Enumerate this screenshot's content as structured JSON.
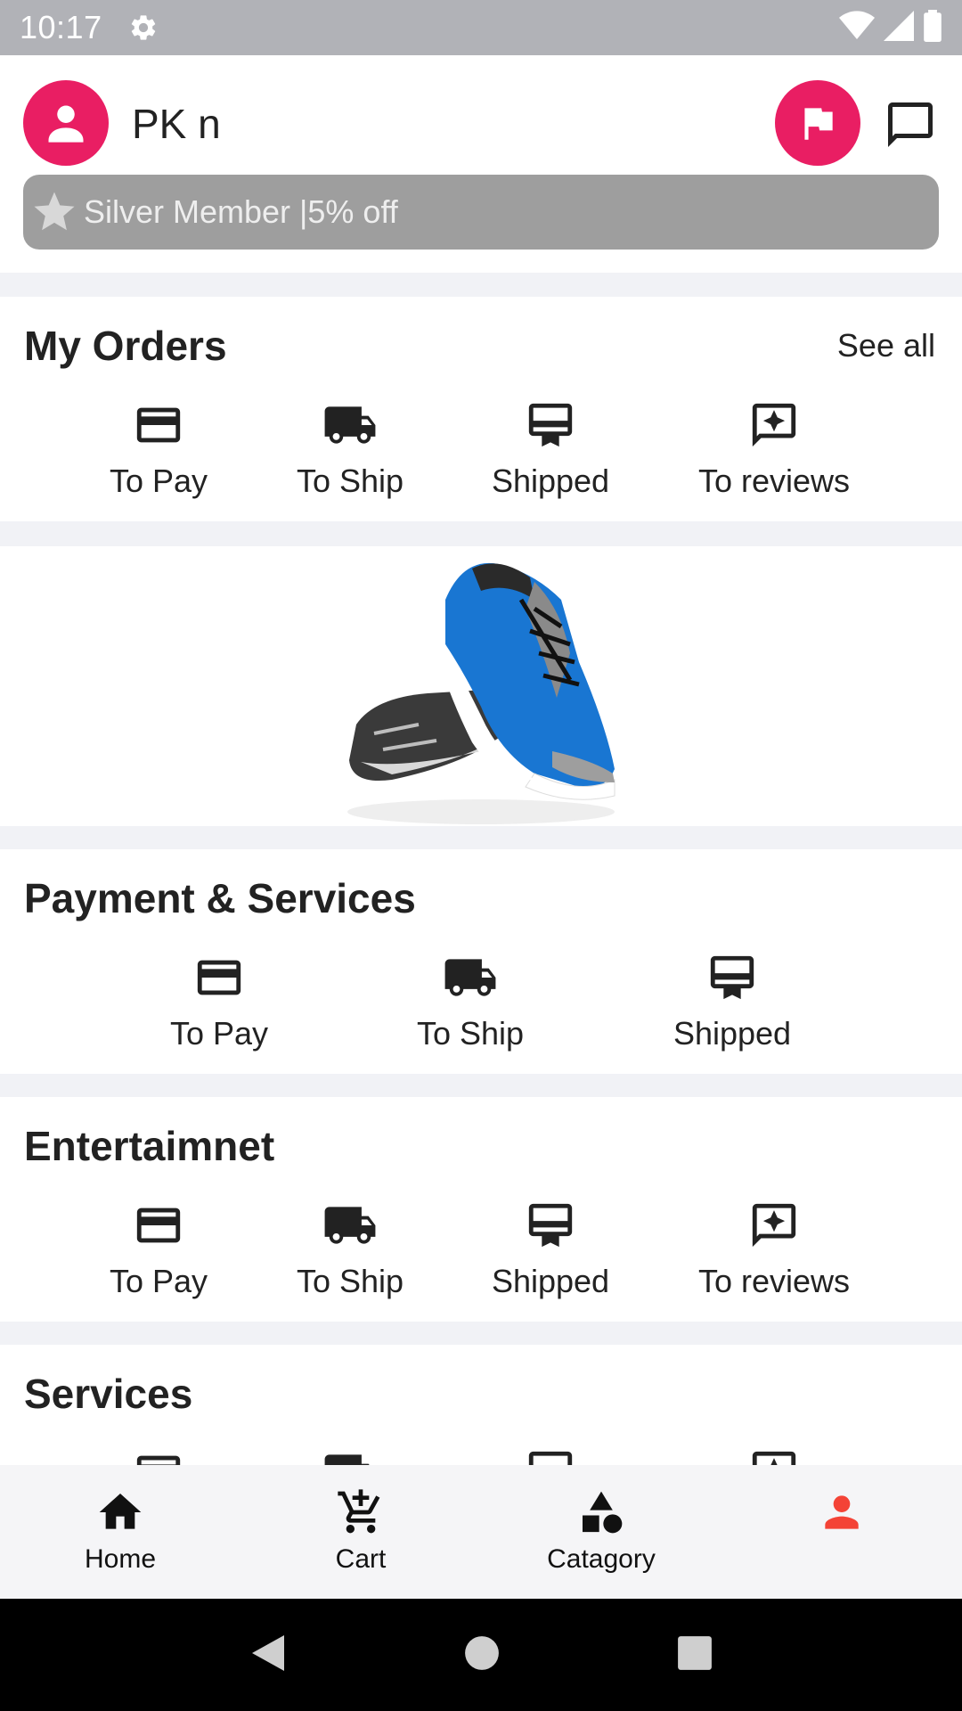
{
  "status_bar": {
    "time": "10:17"
  },
  "profile": {
    "name": "PK n",
    "member_badge": "Silver Member |5% off"
  },
  "colors": {
    "accent": "#e91e63",
    "active_nav": "#f44336",
    "badge": "#9e9e9e"
  },
  "my_orders": {
    "title": "My Orders",
    "see_all": "See all",
    "items": [
      {
        "label": "To Pay",
        "icon": "credit-card-icon"
      },
      {
        "label": "To Ship",
        "icon": "truck-icon"
      },
      {
        "label": "Shipped",
        "icon": "shipped-icon"
      },
      {
        "label": "To reviews",
        "icon": "review-icon"
      }
    ]
  },
  "payment_services": {
    "title": "Payment & Services",
    "items": [
      {
        "label": "To Pay",
        "icon": "credit-card-icon"
      },
      {
        "label": "To Ship",
        "icon": "truck-icon"
      },
      {
        "label": "Shipped",
        "icon": "shipped-icon"
      }
    ]
  },
  "entertainment": {
    "title": "Entertaimnet",
    "items": [
      {
        "label": "To Pay",
        "icon": "credit-card-icon"
      },
      {
        "label": "To Ship",
        "icon": "truck-icon"
      },
      {
        "label": "Shipped",
        "icon": "shipped-icon"
      },
      {
        "label": "To reviews",
        "icon": "review-icon"
      }
    ]
  },
  "services": {
    "title": "Services"
  },
  "bottom_nav": [
    {
      "label": "Home",
      "icon": "home-icon"
    },
    {
      "label": "Cart",
      "icon": "cart-icon"
    },
    {
      "label": "Catagory",
      "icon": "category-icon"
    },
    {
      "label": "",
      "icon": "profile-icon",
      "active": true
    }
  ]
}
